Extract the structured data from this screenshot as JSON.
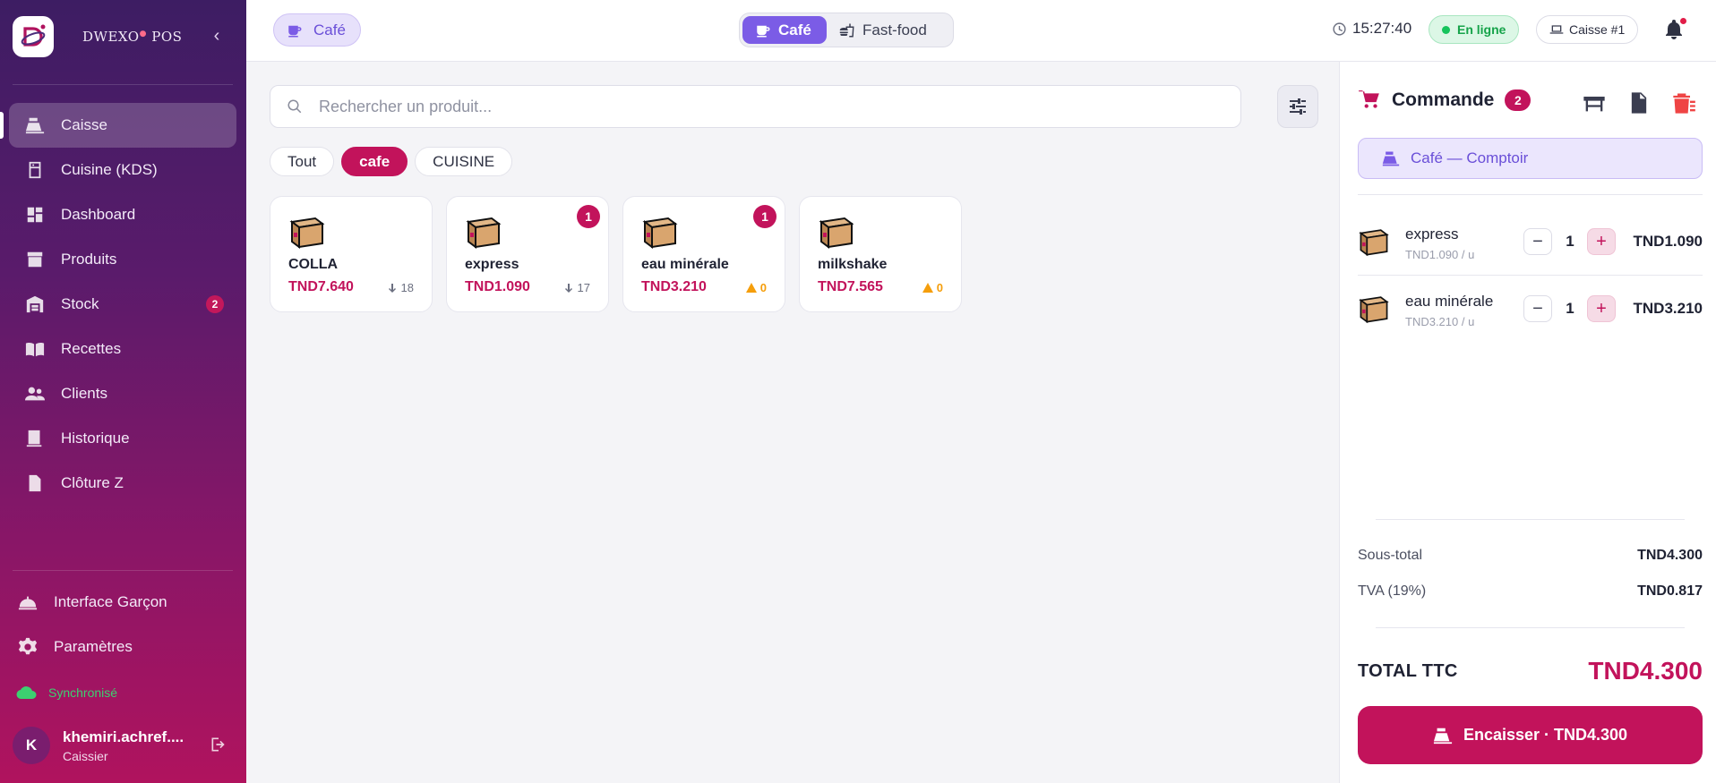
{
  "brand": {
    "name": "DWEXO",
    "suffix": "POS"
  },
  "sidebar": {
    "items": [
      {
        "label": "Caisse",
        "active": true
      },
      {
        "label": "Cuisine (KDS)"
      },
      {
        "label": "Dashboard"
      },
      {
        "label": "Produits"
      },
      {
        "label": "Stock",
        "badge": "2"
      },
      {
        "label": "Recettes"
      },
      {
        "label": "Clients"
      },
      {
        "label": "Historique"
      },
      {
        "label": "Clôture Z"
      }
    ],
    "bottom": [
      {
        "label": "Interface Garçon"
      },
      {
        "label": "Paramètres"
      }
    ],
    "sync_label": "Synchronisé",
    "user": {
      "initial": "K",
      "name": "khemiri.achref....",
      "role": "Caissier"
    }
  },
  "topbar": {
    "mode_chip": "Café",
    "segments": [
      {
        "label": "Café",
        "active": true
      },
      {
        "label": "Fast-food"
      }
    ],
    "time": "15:27:40",
    "status": "En ligne",
    "register": "Caisse #1"
  },
  "search": {
    "placeholder": "Rechercher un produit..."
  },
  "categories": [
    {
      "label": "Tout"
    },
    {
      "label": "cafe",
      "active": true
    },
    {
      "label": "CUISINE"
    }
  ],
  "products": [
    {
      "name": "COLLA",
      "price": "TND7.640",
      "stock": "18",
      "stock_state": "ok",
      "in_cart": ""
    },
    {
      "name": "express",
      "price": "TND1.090",
      "stock": "17",
      "stock_state": "ok",
      "in_cart": "1"
    },
    {
      "name": "eau minérale",
      "price": "TND3.210",
      "stock": "0",
      "stock_state": "warn",
      "in_cart": "1"
    },
    {
      "name": "milkshake",
      "price": "TND7.565",
      "stock": "0",
      "stock_state": "warn",
      "in_cart": ""
    }
  ],
  "order": {
    "title": "Commande",
    "count": "2",
    "location": "Café — Comptoir",
    "lines": [
      {
        "name": "express",
        "unit": "TND1.090 / u",
        "qty": "1",
        "total": "TND1.090"
      },
      {
        "name": "eau minérale",
        "unit": "TND3.210 / u",
        "qty": "1",
        "total": "TND3.210"
      }
    ],
    "subtotal_label": "Sous-total",
    "subtotal": "TND4.300",
    "tax_label": "TVA (19%)",
    "tax": "TND0.817",
    "total_label": "TOTAL TTC",
    "total": "TND4.300",
    "pay_label": "Encaisser · TND4.300"
  },
  "colors": {
    "accent": "#c2135b",
    "purple": "#7b5ce6",
    "online": "#16a34a",
    "warning": "#f59e0b"
  }
}
